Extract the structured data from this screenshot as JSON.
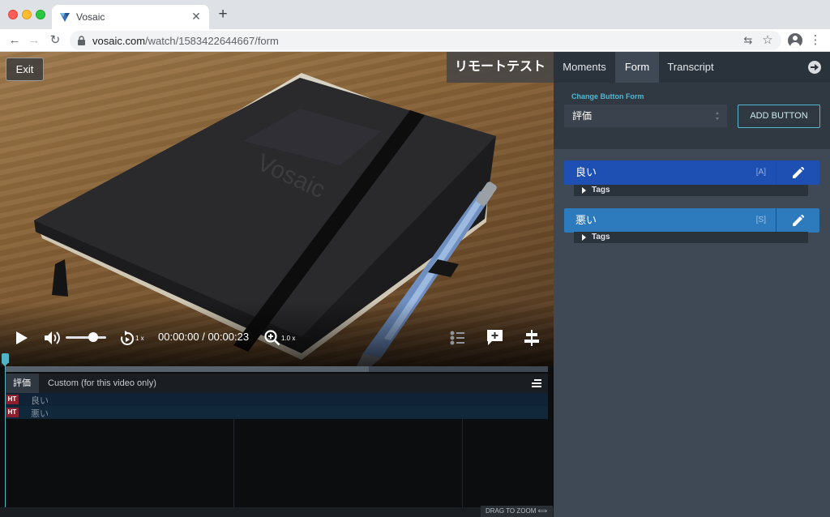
{
  "browser": {
    "tab_title": "Vosaic",
    "url_domain": "vosaic.com",
    "url_path": "/watch/1583422644667/form"
  },
  "video": {
    "exit_label": "Exit",
    "title": "リモートテスト",
    "playback_rate": "1 x",
    "zoom_level": "1.0 x",
    "current_time": "00:00:00",
    "time_separator": " / ",
    "duration": "00:00:23",
    "volume_level": 0.68,
    "buffered_fraction": 0.67
  },
  "timeline": {
    "tabs": [
      "評価",
      "Custom (for this video only)"
    ],
    "rows": [
      {
        "badge": "HT",
        "label": "良い"
      },
      {
        "badge": "HT",
        "label": "悪い"
      }
    ],
    "drag_to_zoom": "DRAG TO ZOOM"
  },
  "panel": {
    "tabs": [
      "Moments",
      "Form",
      "Transcript"
    ],
    "active_tab": "Form",
    "change_button_form_label": "Change Button Form",
    "selected_form": "評価",
    "add_button_label": "ADD BUTTON",
    "buttons": [
      {
        "label": "良い",
        "shortcut": "[A]",
        "tags_label": "Tags",
        "color": "#1e4fb2"
      },
      {
        "label": "悪い",
        "shortcut": "[S]",
        "tags_label": "Tags",
        "color": "#2d7bbd"
      }
    ]
  },
  "colors": {
    "accent": "#4fb9d3",
    "playhead": "#4fb4c6",
    "badge_red": "#8c1f2e"
  }
}
